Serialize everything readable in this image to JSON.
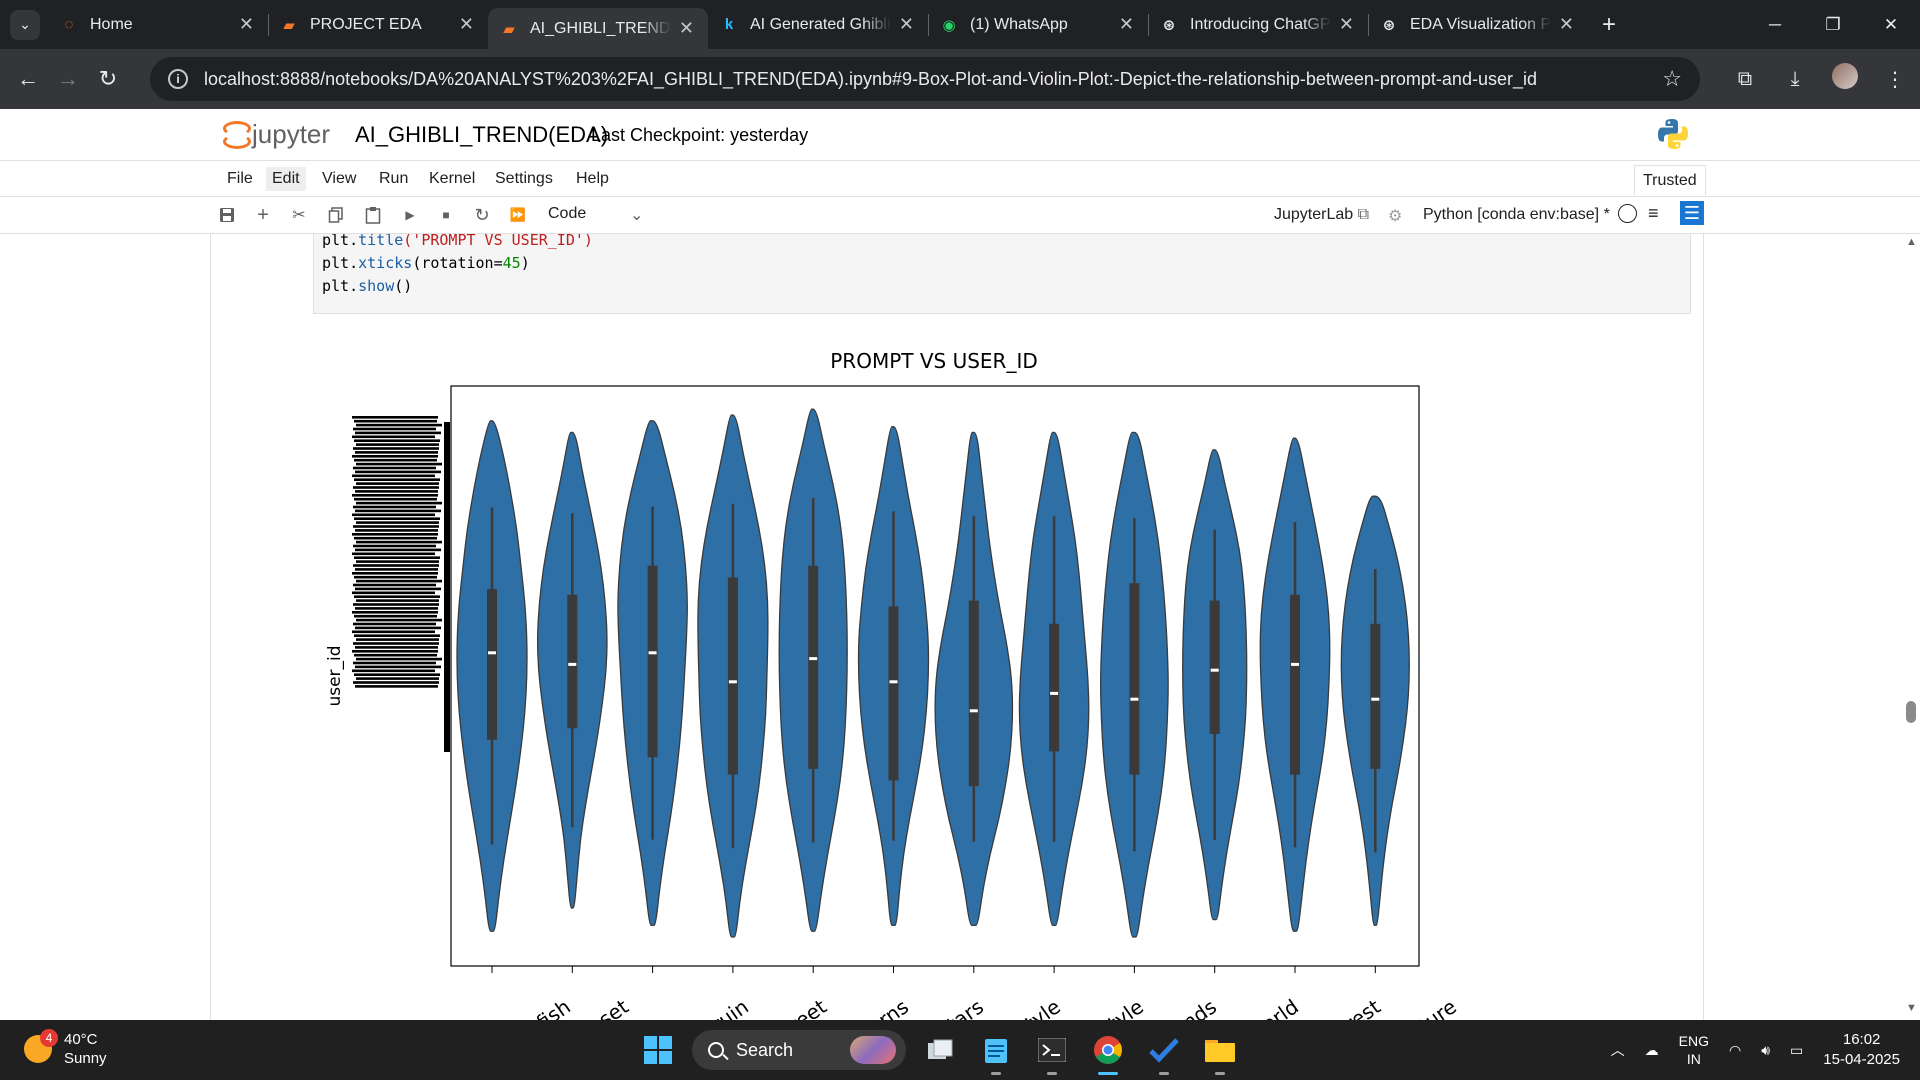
{
  "browser": {
    "tabs": [
      {
        "title": "Home",
        "icon": "jupyter-icon",
        "active": false
      },
      {
        "title": "PROJECT EDA",
        "icon": "notebook-icon",
        "active": false
      },
      {
        "title": "AI_GHIBLI_TREND(EDA)",
        "icon": "notebook-icon",
        "active": true
      },
      {
        "title": "AI Generated Ghibli Style",
        "icon": "kaggle-icon",
        "active": false
      },
      {
        "title": "(1) WhatsApp",
        "icon": "whatsapp-icon",
        "active": false
      },
      {
        "title": "Introducing ChatGPT",
        "icon": "chatgpt-icon",
        "active": false
      },
      {
        "title": "EDA Visualization Practice",
        "icon": "chatgpt-icon",
        "active": false
      }
    ],
    "url": "localhost:8888/notebooks/DA%20ANALYST%203%2FAI_GHIBLI_TREND(EDA).ipynb#9-Box-Plot-and-Violin-Plot:-Depict-the-relationship-between-prompt-and-user_id"
  },
  "jupyter": {
    "logo_text": "jupyter",
    "notebook_title": "AI_GHIBLI_TREND(EDA)",
    "checkpoint": "Last Checkpoint: yesterday",
    "menu": [
      "File",
      "Edit",
      "View",
      "Run",
      "Kernel",
      "Settings",
      "Help"
    ],
    "trusted": "Trusted",
    "cell_type": "Code",
    "jupyterlab_link": "JupyterLab",
    "kernel": "Python [conda env:base] *"
  },
  "code_cell": {
    "line1_obj": "plt.",
    "line1_fn": "title",
    "line1_rest": "('PROMPT VS USER_ID')",
    "line2_obj": "plt.",
    "line2_fn": "xticks",
    "line2_pre": "(rotation=",
    "line2_num": "45",
    "line2_post": ")",
    "line3_obj": "plt.",
    "line3_fn": "show",
    "line3_rest": "()"
  },
  "chart_data": {
    "type": "violin",
    "title": "PROMPT VS USER_ID",
    "xlabel": "",
    "ylabel": "user_id",
    "color": "#2e6fa6",
    "categories": [
      "",
      "nt fish",
      "sunset",
      "",
      "ed ruin",
      "street",
      "nterns",
      "g stars",
      "li-style",
      "li style",
      "islands",
      "world",
      "l forest",
      "eature"
    ],
    "violins": [
      {
        "top": 0.06,
        "bottom": 0.94,
        "median": 0.46,
        "q1": 0.35,
        "q3": 0.61,
        "w": [
          0.03,
          0.12,
          0.19,
          0.25,
          0.29,
          0.33,
          0.35,
          0.35,
          0.33,
          0.29,
          0.24,
          0.18,
          0.12,
          0.07,
          0.03
        ]
      },
      {
        "top": 0.08,
        "bottom": 0.9,
        "median": 0.48,
        "q1": 0.36,
        "q3": 0.59,
        "w": [
          0.03,
          0.09,
          0.16,
          0.23,
          0.29,
          0.33,
          0.35,
          0.34,
          0.3,
          0.25,
          0.19,
          0.13,
          0.08,
          0.05,
          0.02
        ]
      },
      {
        "top": 0.06,
        "bottom": 0.93,
        "median": 0.46,
        "q1": 0.31,
        "q3": 0.64,
        "w": [
          0.04,
          0.13,
          0.22,
          0.29,
          0.33,
          0.35,
          0.34,
          0.32,
          0.3,
          0.27,
          0.23,
          0.18,
          0.12,
          0.07,
          0.03
        ]
      },
      {
        "top": 0.05,
        "bottom": 0.95,
        "median": 0.51,
        "q1": 0.33,
        "q3": 0.67,
        "w": [
          0.03,
          0.1,
          0.18,
          0.26,
          0.32,
          0.35,
          0.35,
          0.34,
          0.33,
          0.3,
          0.26,
          0.2,
          0.13,
          0.07,
          0.03
        ]
      },
      {
        "top": 0.04,
        "bottom": 0.94,
        "median": 0.47,
        "q1": 0.31,
        "q3": 0.66,
        "w": [
          0.03,
          0.11,
          0.2,
          0.27,
          0.31,
          0.33,
          0.34,
          0.34,
          0.33,
          0.31,
          0.27,
          0.21,
          0.14,
          0.08,
          0.03
        ]
      },
      {
        "top": 0.07,
        "bottom": 0.93,
        "median": 0.51,
        "q1": 0.38,
        "q3": 0.68,
        "w": [
          0.03,
          0.09,
          0.15,
          0.22,
          0.28,
          0.32,
          0.35,
          0.35,
          0.33,
          0.29,
          0.23,
          0.16,
          0.1,
          0.06,
          0.03
        ]
      },
      {
        "top": 0.08,
        "bottom": 0.93,
        "median": 0.56,
        "q1": 0.37,
        "q3": 0.69,
        "w": [
          0.03,
          0.07,
          0.11,
          0.15,
          0.2,
          0.26,
          0.33,
          0.38,
          0.39,
          0.37,
          0.32,
          0.25,
          0.16,
          0.09,
          0.04
        ]
      },
      {
        "top": 0.08,
        "bottom": 0.93,
        "median": 0.53,
        "q1": 0.41,
        "q3": 0.63,
        "w": [
          0.03,
          0.09,
          0.15,
          0.21,
          0.25,
          0.28,
          0.31,
          0.34,
          0.35,
          0.33,
          0.28,
          0.21,
          0.14,
          0.08,
          0.03
        ]
      },
      {
        "top": 0.08,
        "bottom": 0.95,
        "median": 0.54,
        "q1": 0.34,
        "q3": 0.67,
        "w": [
          0.04,
          0.11,
          0.18,
          0.24,
          0.28,
          0.31,
          0.33,
          0.34,
          0.33,
          0.31,
          0.27,
          0.21,
          0.14,
          0.08,
          0.03
        ]
      },
      {
        "top": 0.11,
        "bottom": 0.92,
        "median": 0.49,
        "q1": 0.37,
        "q3": 0.6,
        "w": [
          0.03,
          0.1,
          0.18,
          0.25,
          0.29,
          0.31,
          0.32,
          0.32,
          0.31,
          0.28,
          0.24,
          0.18,
          0.12,
          0.07,
          0.03
        ]
      },
      {
        "top": 0.09,
        "bottom": 0.94,
        "median": 0.48,
        "q1": 0.36,
        "q3": 0.67,
        "w": [
          0.03,
          0.1,
          0.17,
          0.24,
          0.3,
          0.34,
          0.35,
          0.34,
          0.32,
          0.28,
          0.22,
          0.16,
          0.11,
          0.07,
          0.03
        ]
      },
      {
        "top": 0.19,
        "bottom": 0.93,
        "median": 0.54,
        "q1": 0.41,
        "q3": 0.66,
        "w": [
          0.05,
          0.14,
          0.22,
          0.28,
          0.32,
          0.34,
          0.34,
          0.32,
          0.28,
          0.23,
          0.17,
          0.12,
          0.08,
          0.05,
          0.02
        ]
      }
    ]
  },
  "taskbar": {
    "weather_temp": "40°C",
    "weather_desc": "Sunny",
    "weather_badge": "4",
    "search": "Search",
    "lang1": "ENG",
    "lang2": "IN",
    "time": "16:02",
    "date": "15-04-2025"
  }
}
